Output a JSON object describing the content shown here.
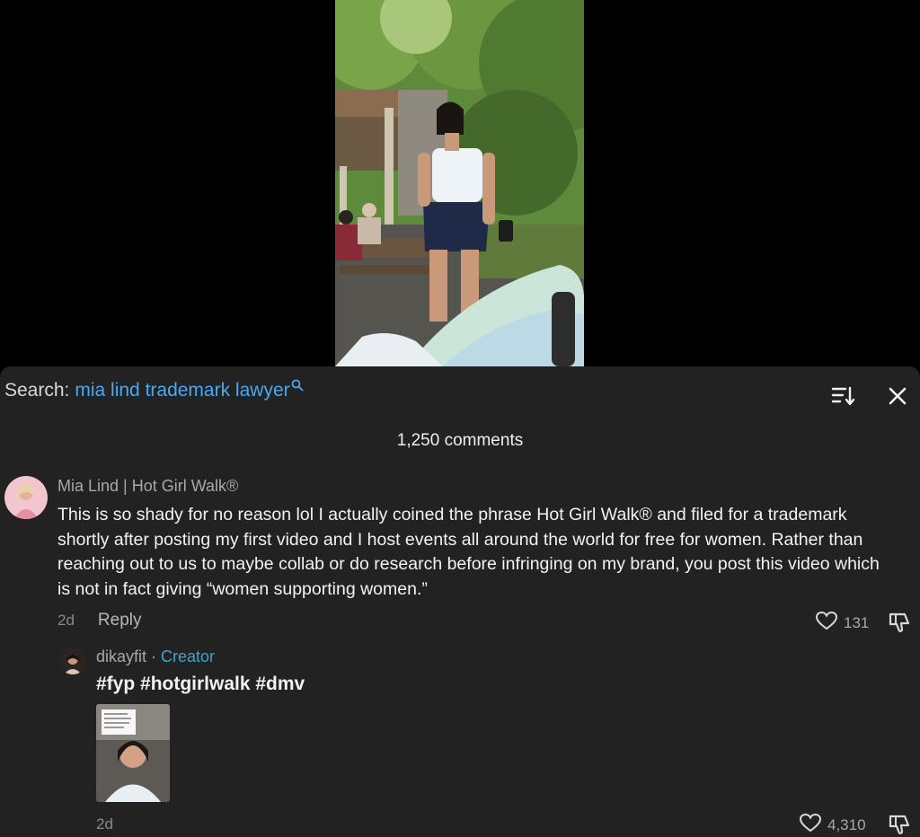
{
  "search": {
    "label": "Search:",
    "query": "mia lind trademark lawyer"
  },
  "comments_count": "1,250 comments",
  "comments": [
    {
      "author": "Mia Lind | Hot Girl Walk®",
      "text": "This is so shady for no reason lol I actually coined the phrase Hot Girl Walk® and filed for a trademark shortly after posting my first video and I host events all around the world for free for women. Rather than reaching out to us to maybe collab or do research before infringing on my brand, you post this video which is not in fact giving “women supporting women.”",
      "time": "2d",
      "reply_label": "Reply",
      "likes": "131"
    },
    {
      "author": "dikayfit",
      "separator": "·",
      "badge": "Creator",
      "text": "#fyp #hotgirlwalk #dmv",
      "time": "2d",
      "likes": "4,310"
    }
  ],
  "colors": {
    "sheet_background": "#222222",
    "search_query": "#4aa8f0",
    "creator_badge": "#3ea6c9"
  },
  "icons": [
    "search-icon",
    "sort-icon",
    "close-icon",
    "heart-icon",
    "dislike-icon"
  ]
}
